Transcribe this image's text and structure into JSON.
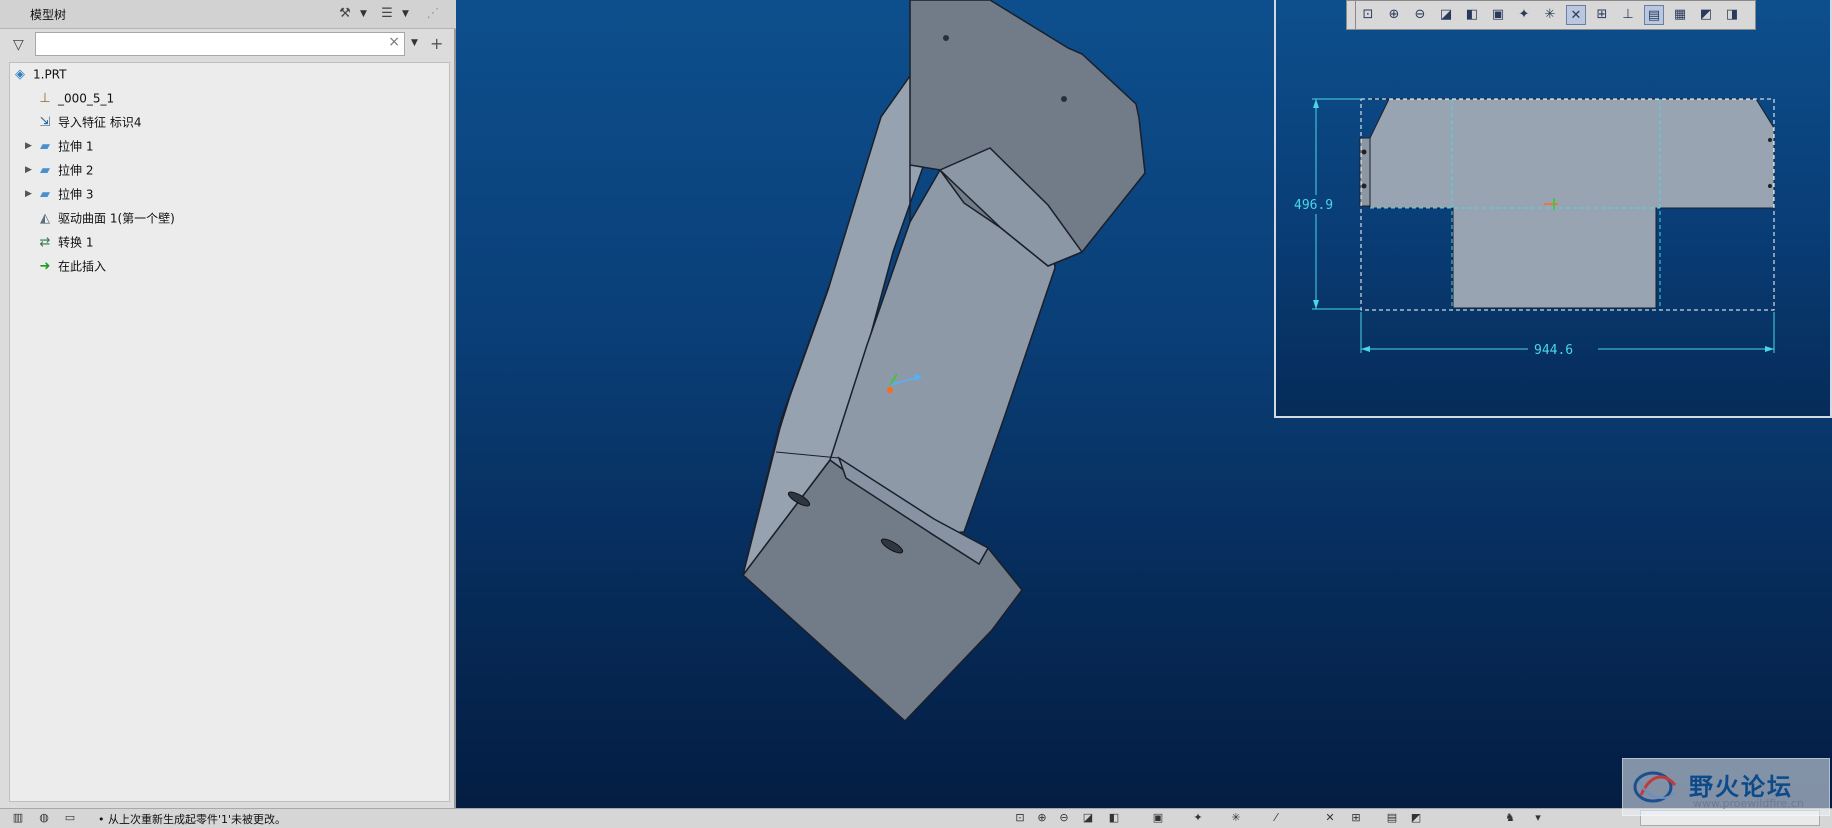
{
  "sidebar": {
    "title": "模型树",
    "search": {
      "value": "",
      "placeholder": ""
    },
    "tree": [
      {
        "label": "1.PRT",
        "icon": "part-icon",
        "expandable": false
      },
      {
        "label": "_000_5_1",
        "icon": "coordinate-system-icon",
        "expandable": false
      },
      {
        "label": "导入特征 标识4",
        "icon": "import-feature-icon",
        "expandable": false
      },
      {
        "label": "拉伸 1",
        "icon": "extrude-icon",
        "expandable": true
      },
      {
        "label": "拉伸 2",
        "icon": "extrude-icon",
        "expandable": true
      },
      {
        "label": "拉伸 3",
        "icon": "extrude-icon",
        "expandable": true
      },
      {
        "label": "驱动曲面 1(第一个壁)",
        "icon": "driving-surface-icon",
        "expandable": false
      },
      {
        "label": "转换 1",
        "icon": "conversion-icon",
        "expandable": false
      },
      {
        "label": "在此插入",
        "icon": "insert-here-arrow-icon",
        "expandable": false
      }
    ]
  },
  "inset": {
    "dim_height": "496.9",
    "dim_width": "944.6"
  },
  "statusbar": {
    "message": "• 从上次重新生成起零件'1'未被更改。"
  },
  "watermark": {
    "text": "野火论坛",
    "url": "www.proewildfire.cn"
  },
  "colors": {
    "background_top": "#0d4f8d",
    "background_bottom": "#041d42",
    "model_face_light": "#8f9aa8",
    "model_face_dark": "#737c89",
    "dimension": "#49d7e6"
  }
}
